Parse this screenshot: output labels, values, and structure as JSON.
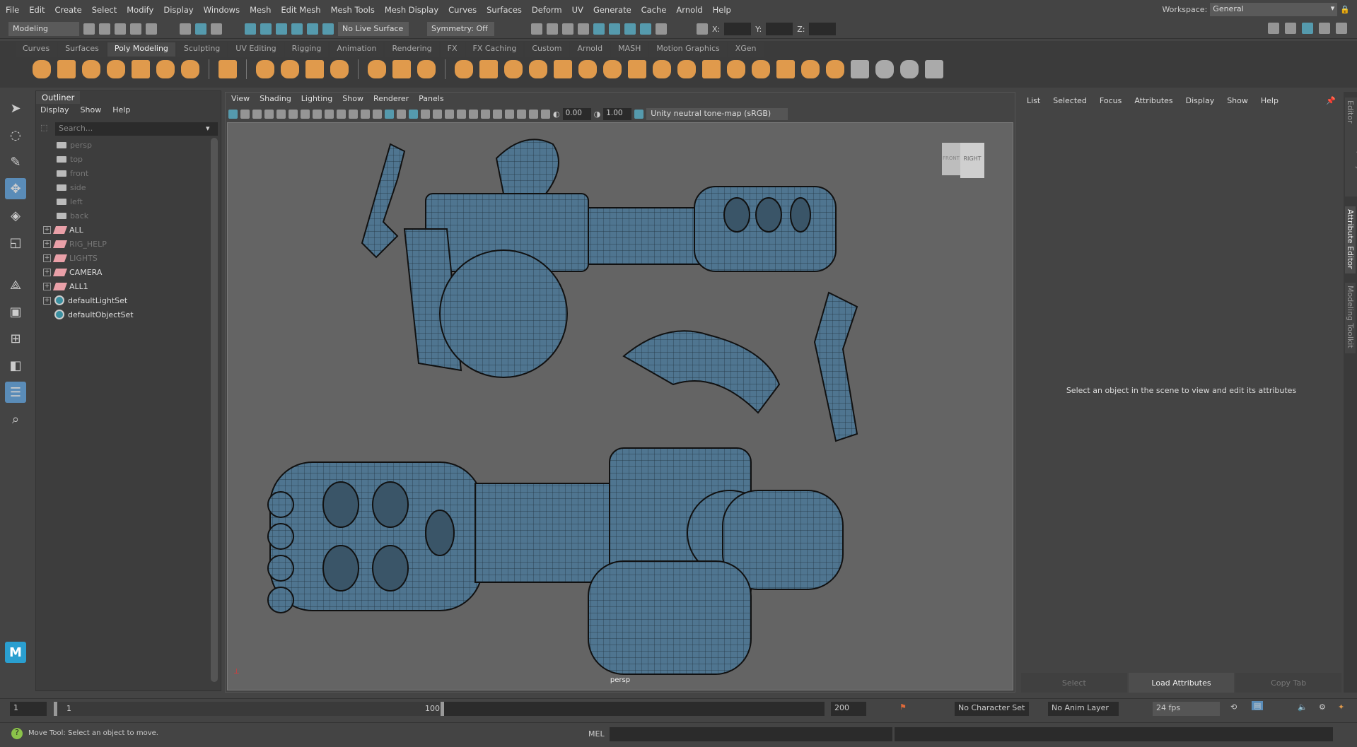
{
  "menubar": {
    "items": [
      "File",
      "Edit",
      "Create",
      "Select",
      "Modify",
      "Display",
      "Windows",
      "Mesh",
      "Edit Mesh",
      "Mesh Tools",
      "Mesh Display",
      "Curves",
      "Surfaces",
      "Deform",
      "UV",
      "Generate",
      "Cache",
      "Arnold",
      "Help"
    ],
    "workspace_label": "Workspace:",
    "workspace_value": "General"
  },
  "status": {
    "mode": "Modeling",
    "live_surface": "No Live Surface",
    "symmetry": "Symmetry: Off",
    "x_label": "X:",
    "y_label": "Y:",
    "z_label": "Z:"
  },
  "shelf": {
    "tabs": [
      "Curves",
      "Surfaces",
      "Poly Modeling",
      "Sculpting",
      "UV Editing",
      "Rigging",
      "Animation",
      "Rendering",
      "FX",
      "FX Caching",
      "Custom",
      "Arnold",
      "MASH",
      "Motion Graphics",
      "XGen"
    ],
    "active": "Poly Modeling",
    "accent": "#e09a4c"
  },
  "outliner": {
    "tab": "Outliner",
    "menu": [
      "Display",
      "Show",
      "Help"
    ],
    "search_placeholder": "Search...",
    "items": [
      {
        "label": "persp",
        "type": "camera"
      },
      {
        "label": "top",
        "type": "camera"
      },
      {
        "label": "front",
        "type": "camera"
      },
      {
        "label": "side",
        "type": "camera"
      },
      {
        "label": "left",
        "type": "camera"
      },
      {
        "label": "back",
        "type": "camera"
      },
      {
        "label": "ALL",
        "type": "layer"
      },
      {
        "label": "RIG_HELP",
        "type": "layer",
        "dim": true
      },
      {
        "label": "LIGHTS",
        "type": "layer",
        "dim": true
      },
      {
        "label": "CAMERA",
        "type": "layer"
      },
      {
        "label": "ALL1",
        "type": "layer"
      },
      {
        "label": "defaultLightSet",
        "type": "set"
      },
      {
        "label": "defaultObjectSet",
        "type": "set"
      }
    ]
  },
  "viewport": {
    "menu": [
      "View",
      "Shading",
      "Lighting",
      "Show",
      "Renderer",
      "Panels"
    ],
    "exposure": "0.00",
    "gamma": "1.00",
    "colorspace": "Unity neutral tone-map (sRGB)",
    "camera": "persp",
    "cube_front": "FRONT",
    "cube_right": "RIGHT",
    "model_color": "#4f7590"
  },
  "attribute_editor": {
    "menu": [
      "List",
      "Selected",
      "Focus",
      "Attributes",
      "Display",
      "Show",
      "Help"
    ],
    "message": "Select an object in the scene to view and edit its attributes",
    "buttons": [
      "Select",
      "Load Attributes",
      "Copy Tab"
    ]
  },
  "side_tabs": [
    "Channel Box / Layer Editor",
    "Attribute Editor",
    "Modeling Toolkit"
  ],
  "timeline": {
    "start": "1",
    "range_start": "1",
    "range_end": "100",
    "end": "200",
    "character_set": "No Character Set",
    "anim_layer": "No Anim Layer",
    "fps": "24 fps"
  },
  "helpline": {
    "message": "Move Tool: Select an object to move.",
    "mel_label": "MEL"
  }
}
